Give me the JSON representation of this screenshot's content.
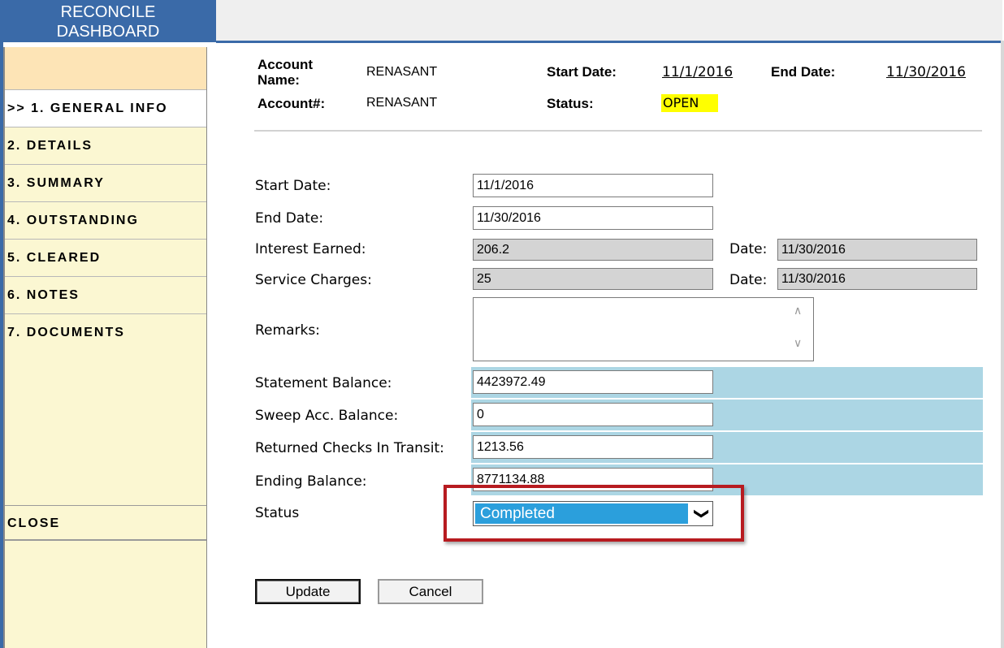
{
  "header": {
    "title_line1": "RECONCILE",
    "title_line2": "DASHBOARD"
  },
  "sidebar": {
    "items": [
      {
        "label": ">> 1. GENERAL INFO",
        "active": true
      },
      {
        "label": "2. DETAILS"
      },
      {
        "label": "3. SUMMARY"
      },
      {
        "label": "4. OUTSTANDING"
      },
      {
        "label": "5. CLEARED"
      },
      {
        "label": "6. NOTES"
      },
      {
        "label": "7. DOCUMENTS"
      }
    ],
    "close_label": "CLOSE"
  },
  "info": {
    "account_name_label_1": "Account",
    "account_name_label_2": "Name:",
    "account_name_value": "RENASANT",
    "account_no_label": "Account#:",
    "account_no_value": "RENASANT",
    "start_date_label": "Start Date:",
    "start_date_value": "11/1/2016",
    "end_date_label": "End Date:",
    "end_date_value": "11/30/2016",
    "status_label": "Status:",
    "status_value": "OPEN",
    "status_color": "#ffff00"
  },
  "form": {
    "start_date": {
      "label": "Start Date:",
      "value": "11/1/2016"
    },
    "end_date": {
      "label": "End Date:",
      "value": "11/30/2016"
    },
    "interest_earned": {
      "label": "Interest Earned:",
      "value": "206.2",
      "date_label": "Date:",
      "date_value": "11/30/2016"
    },
    "service_charges": {
      "label": "Service Charges:",
      "value": "25",
      "date_label": "Date:",
      "date_value": "11/30/2016"
    },
    "remarks": {
      "label": "Remarks:",
      "value": ""
    },
    "statement_balance": {
      "label": "Statement Balance:",
      "value": "4423972.49"
    },
    "sweep_balance": {
      "label": "Sweep Acc. Balance:",
      "value": "0"
    },
    "returned_checks": {
      "label": "Returned Checks In Transit:",
      "value": "1213.56"
    },
    "ending_balance": {
      "label": "Ending Balance:",
      "value": "8771134.88"
    },
    "status": {
      "label": "Status",
      "selected": "Completed"
    }
  },
  "buttons": {
    "update": "Update",
    "cancel": "Cancel"
  },
  "colors": {
    "header_blue": "#3a6aa8",
    "sidebar_bg": "#fbf7d2",
    "strip_blue": "#acd6e4",
    "highlight_red": "#b71b20",
    "select_blue": "#2b9fdc"
  }
}
